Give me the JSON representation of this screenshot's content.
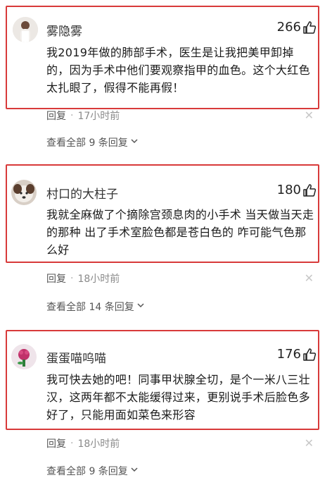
{
  "comments": [
    {
      "username": "雾隐雾",
      "likes": "266",
      "text": "我2019年做的肺部手术，医生是让我把美甲卸掉的，因为手术中他们要观察指甲的血色。这个大红色太扎眼了，假得不能再假！",
      "reply_label": "回复",
      "time": "17小时前",
      "view_all": "查看全部 9 条回复"
    },
    {
      "username": "村口的大柱子",
      "likes": "180",
      "text": "我就全麻做了个摘除宫颈息肉的小手术 当天做当天走的那种 出了手术室脸色都是苍白色的 咋可能气色那么好",
      "reply_label": "回复",
      "time": "18小时前",
      "view_all": "查看全部 14 条回复"
    },
    {
      "username": "蛋蛋喵呜喵",
      "likes": "176",
      "text": "我可快去她的吧！同事甲状腺全切，是个一米八三壮汉，这两年都不太能缓得过来，更别说手术后脸色多好了，只能用面如菜色来形容",
      "reply_label": "回复",
      "time": "18小时前",
      "view_all": "查看全部 9 条回复"
    }
  ],
  "colors": {
    "highlight_border": "#d83a3a",
    "meta_text": "#8a8a8a"
  },
  "icons": {
    "like": "thumbs-up-icon",
    "close": "close-icon",
    "expand": "chevron-down-icon"
  }
}
